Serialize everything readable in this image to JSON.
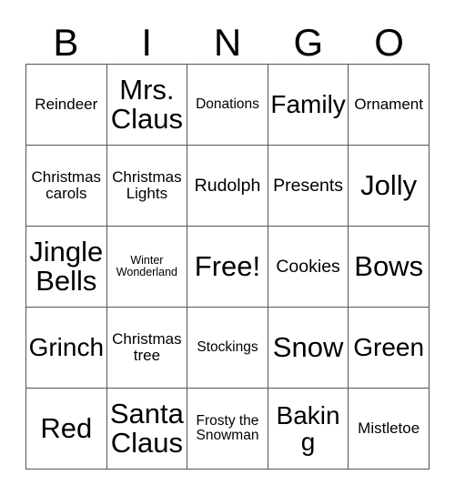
{
  "card": {
    "headers": [
      "B",
      "I",
      "N",
      "G",
      "O"
    ],
    "rows": [
      [
        {
          "text": "Reindeer",
          "size": "md"
        },
        {
          "text": "Mrs. Claus",
          "size": "3xl"
        },
        {
          "text": "Donations",
          "size": "sm"
        },
        {
          "text": "Family",
          "size": "2xl"
        },
        {
          "text": "Ornament",
          "size": "md"
        }
      ],
      [
        {
          "text": "Christmas carols",
          "size": "md"
        },
        {
          "text": "Christmas Lights",
          "size": "md"
        },
        {
          "text": "Rudolph",
          "size": "lg"
        },
        {
          "text": "Presents",
          "size": "lg"
        },
        {
          "text": "Jolly",
          "size": "3xl"
        }
      ],
      [
        {
          "text": "Jingle Bells",
          "size": "3xl"
        },
        {
          "text": "Winter Wonderland",
          "size": "xs"
        },
        {
          "text": "Free!",
          "size": "3xl"
        },
        {
          "text": "Cookies",
          "size": "lg"
        },
        {
          "text": "Bows",
          "size": "3xl"
        }
      ],
      [
        {
          "text": "Grinch",
          "size": "2xl"
        },
        {
          "text": "Christmas tree",
          "size": "md"
        },
        {
          "text": "Stockings",
          "size": "sm"
        },
        {
          "text": "Snow",
          "size": "3xl"
        },
        {
          "text": "Green",
          "size": "2xl"
        }
      ],
      [
        {
          "text": "Red",
          "size": "3xl"
        },
        {
          "text": "Santa Claus",
          "size": "3xl"
        },
        {
          "text": "Frosty the Snowman",
          "size": "sm"
        },
        {
          "text": "Baking",
          "size": "2xl"
        },
        {
          "text": "Mistletoe",
          "size": "md"
        }
      ]
    ],
    "colors": {
      "text": "#000000",
      "grid_line": "#555555",
      "background": "#ffffff"
    }
  }
}
